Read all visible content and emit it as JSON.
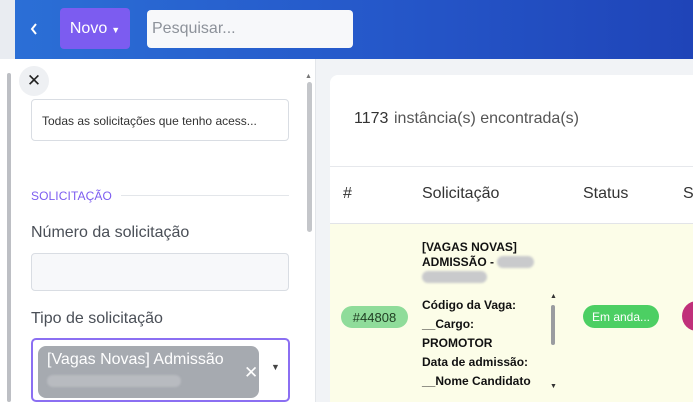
{
  "topbar": {
    "novo_label": "Novo",
    "search_placeholder": "Pesquisar..."
  },
  "filter_panel": {
    "scope_value": "Todas as solicitações que tenho acess...",
    "section_title": "SOLICITAÇÃO",
    "numero_label": "Número da solicitação",
    "numero_value": "",
    "tipo_label": "Tipo de solicitação",
    "tipo_tag": "[Vagas Novas] Admissão"
  },
  "results": {
    "count": "1173",
    "count_label": "instância(s) encontrada(s)",
    "columns": [
      "#",
      "Solicitação",
      "Status",
      "S"
    ],
    "rows": [
      {
        "id": "#44808",
        "title_line1": "[VAGAS NOVAS]",
        "title_line2": "ADMISSÃO -",
        "details": [
          "Código da Vaga:",
          "__Cargo:",
          "PROMOTOR",
          "Data de admissão:",
          "__Nome Candidato"
        ],
        "status": "Em anda..."
      }
    ]
  },
  "colors": {
    "brand_purple": "#7c5cf0",
    "topbar_blue": "#2557c9",
    "status_green": "#4ccf63",
    "id_badge_green": "#8fdc9a"
  }
}
